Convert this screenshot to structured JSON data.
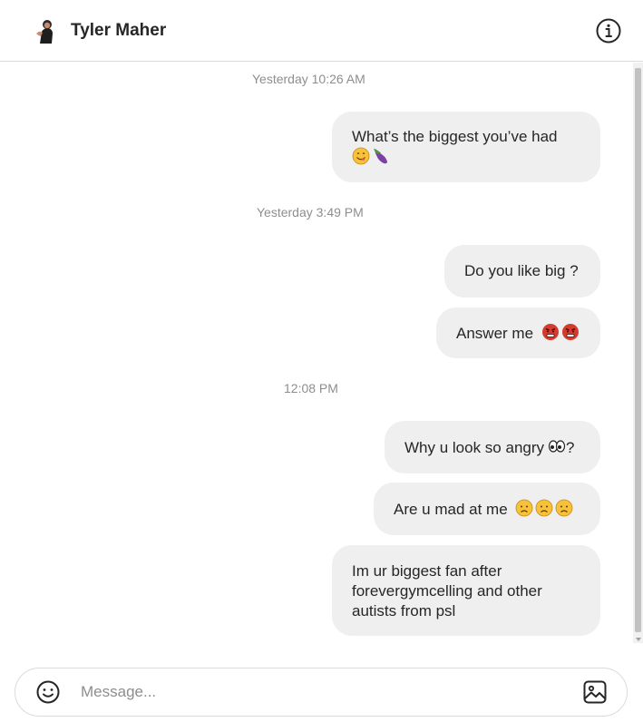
{
  "header": {
    "contact_name": "Tyler Maher",
    "avatar_icon": "profile-photo",
    "info_icon": "info-icon"
  },
  "thread": {
    "timestamps": [
      "Yesterday 10:26 AM",
      "Yesterday 3:49 PM",
      "12:08 PM"
    ],
    "messages": [
      {
        "text": "What’s the biggest you’ve had",
        "emojis": [
          "yum-face",
          "eggplant"
        ]
      },
      {
        "text": "Do you like big ?",
        "emojis": []
      },
      {
        "text": "Answer me",
        "emojis": [
          "angry-face",
          "angry-face"
        ]
      },
      {
        "text": "Why u look so angry",
        "emojis": [
          "eyes"
        ],
        "suffix": "?"
      },
      {
        "text": "Are u mad at me",
        "emojis": [
          "sad-face",
          "sad-face",
          "sad-face"
        ]
      },
      {
        "text": "Im ur biggest fan after forevergymcelling and other autists from psl",
        "emojis": []
      }
    ]
  },
  "composer": {
    "placeholder": "Message...",
    "emoji_icon": "smiley-icon",
    "image_icon": "image-icon"
  },
  "colors": {
    "bubble": "#efefef",
    "text": "#262626",
    "muted": "#8e8e8e",
    "border": "#dbdbdb"
  }
}
